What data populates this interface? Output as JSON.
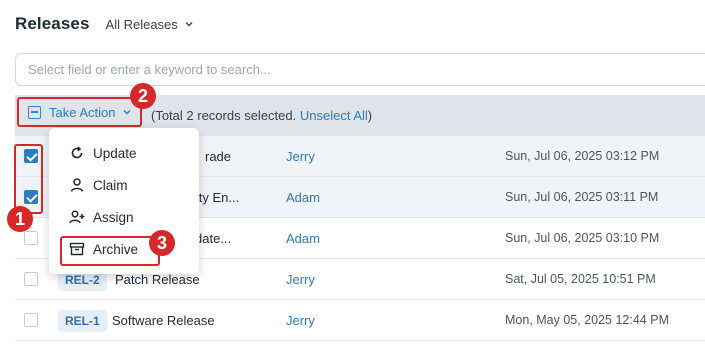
{
  "header": {
    "title": "Releases",
    "view_label": "All Releases"
  },
  "search": {
    "placeholder": "Select field or enter a keyword to search..."
  },
  "action_bar": {
    "take_action_label": "Take Action",
    "selection_prefix": "(Total 2 records selected. ",
    "unselect_label": "Unselect All",
    "selection_suffix": ")"
  },
  "menu": {
    "items": [
      {
        "label": "Update",
        "icon": "refresh-icon"
      },
      {
        "label": "Claim",
        "icon": "user-icon"
      },
      {
        "label": "Assign",
        "icon": "user-plus-icon"
      },
      {
        "label": "Archive",
        "icon": "archive-icon"
      }
    ]
  },
  "rows": [
    {
      "checked": true,
      "tag": "",
      "name": "rade",
      "owner": "Jerry",
      "date": "Sun, Jul 06, 2025 03:12 PM"
    },
    {
      "checked": true,
      "tag": "",
      "name": "lity En...",
      "owner": "Adam",
      "date": "Sun, Jul 06, 2025 03:11 PM"
    },
    {
      "checked": false,
      "tag": "",
      "name": "date...",
      "owner": "Adam",
      "date": "Sun, Jul 06, 2025 03:10 PM"
    },
    {
      "checked": false,
      "tag": "REL-2",
      "name": "Patch Release",
      "owner": "Jerry",
      "date": "Sat, Jul 05, 2025 10:51 PM"
    },
    {
      "checked": false,
      "tag": "REL-1",
      "name": "Software Release",
      "owner": "Jerry",
      "date": "Mon, May 05, 2025 12:44 PM"
    }
  ],
  "annotations": {
    "one": "1",
    "two": "2",
    "three": "3"
  },
  "colors": {
    "accent": "#2f7bbf",
    "highlight": "#d62828",
    "action_bar_bg": "#dfe3ea"
  }
}
